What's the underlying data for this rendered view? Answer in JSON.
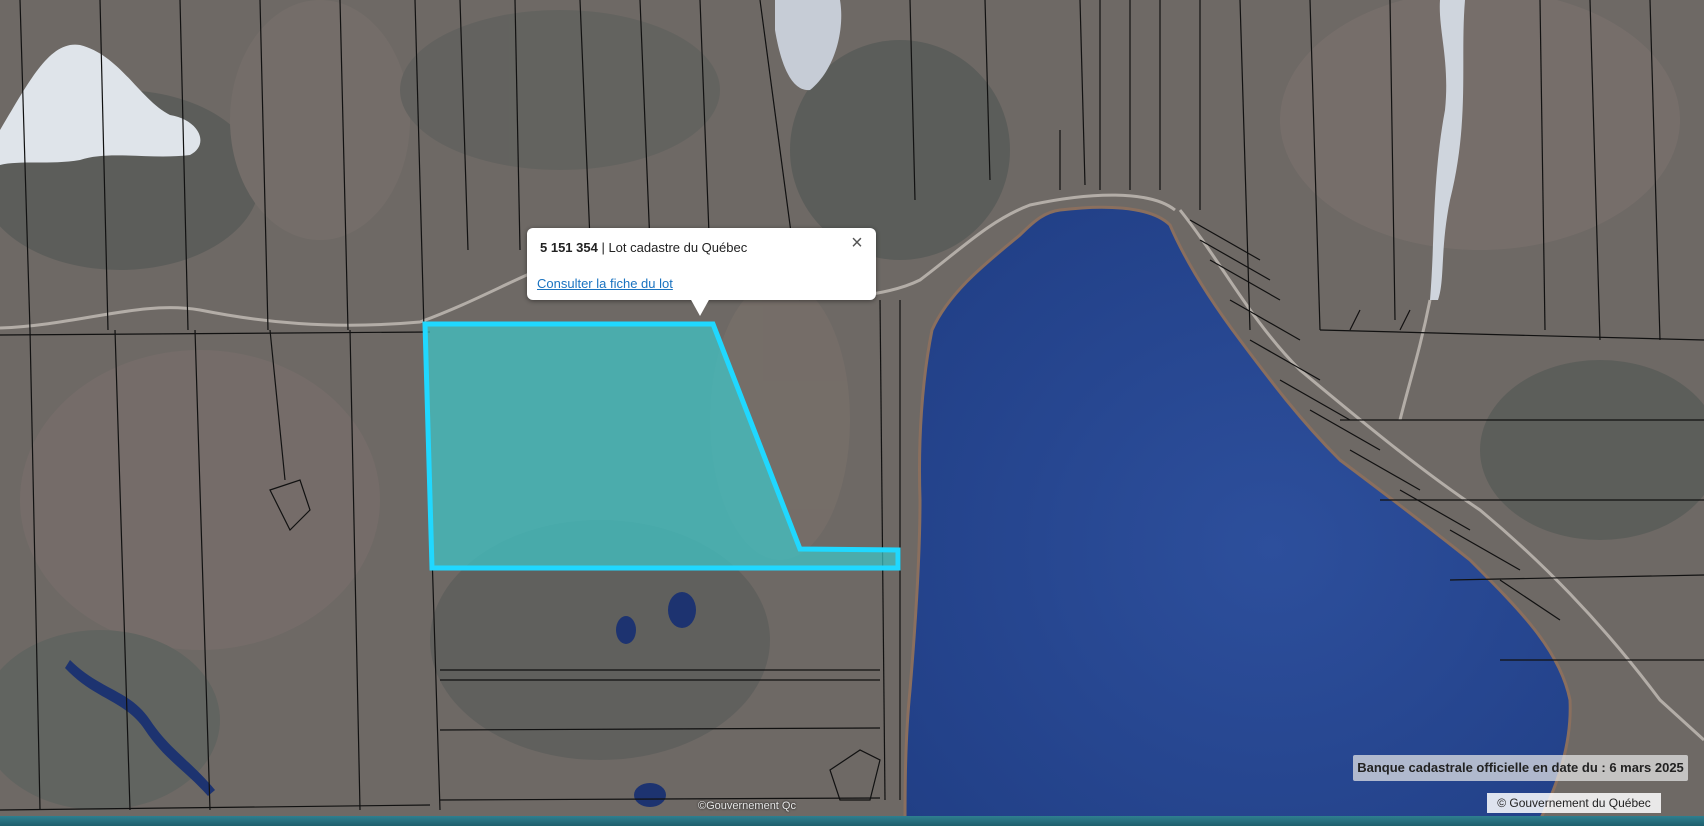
{
  "popup": {
    "lot_number": "5 151 354",
    "separator": " | ",
    "lot_type": "Lot cadastre du Québec",
    "link_label": "Consulter la fiche du lot",
    "close_label": "×"
  },
  "footer": {
    "date_label": "Banque cadastrale officielle en date du : 6 mars 2025",
    "attribution": "© Gouvernement du Québec",
    "imagery_credit": "©Gouvernement Qc"
  },
  "colors": {
    "land": "#6f6a67",
    "lake": "#2a4a93",
    "selected_lot_fill": "#3fc6c8",
    "selected_lot_stroke": "#20d8ff",
    "lot_lines": "#111111",
    "road": "#b8b2ac"
  }
}
